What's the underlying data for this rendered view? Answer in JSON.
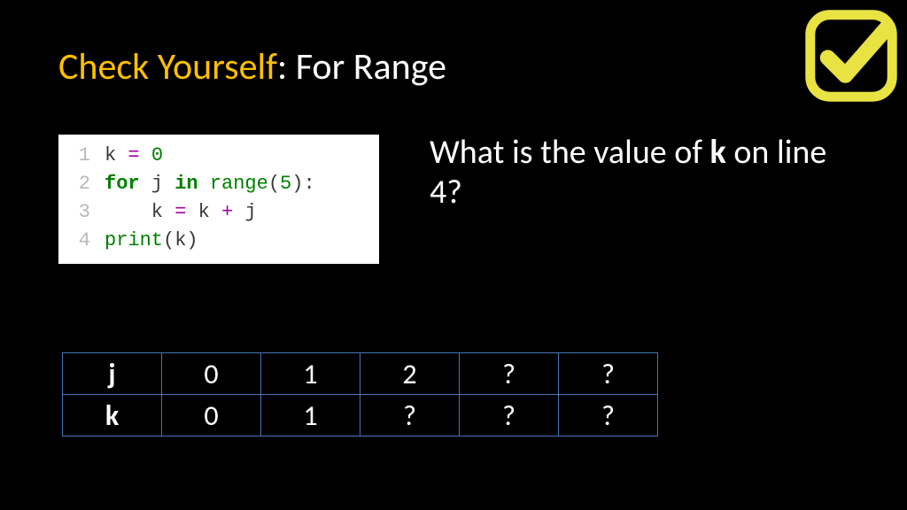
{
  "title": {
    "accent": "Check Yourself",
    "sep": ": ",
    "rest": "For Range"
  },
  "icon": {
    "name": "checkmark-box-icon"
  },
  "code": {
    "lines": [
      {
        "n": "1",
        "tokens": [
          {
            "t": "k ",
            "c": "plain"
          },
          {
            "t": "=",
            "c": "op"
          },
          {
            "t": " ",
            "c": "plain"
          },
          {
            "t": "0",
            "c": "num"
          }
        ]
      },
      {
        "n": "2",
        "tokens": [
          {
            "t": "for",
            "c": "kw"
          },
          {
            "t": " j ",
            "c": "plain"
          },
          {
            "t": "in",
            "c": "kw"
          },
          {
            "t": " ",
            "c": "plain"
          },
          {
            "t": "range",
            "c": "fn"
          },
          {
            "t": "(",
            "c": "plain"
          },
          {
            "t": "5",
            "c": "num"
          },
          {
            "t": "):",
            "c": "plain"
          }
        ]
      },
      {
        "n": "3",
        "tokens": [
          {
            "t": "    k ",
            "c": "plain"
          },
          {
            "t": "=",
            "c": "op"
          },
          {
            "t": " k ",
            "c": "plain"
          },
          {
            "t": "+",
            "c": "op"
          },
          {
            "t": " j",
            "c": "plain"
          }
        ]
      },
      {
        "n": "4",
        "tokens": [
          {
            "t": "print",
            "c": "fn"
          },
          {
            "t": "(k)",
            "c": "plain"
          }
        ]
      }
    ]
  },
  "question": {
    "pre": "What is the value of ",
    "var": "k",
    "post": " on line 4?"
  },
  "table": {
    "rows": [
      {
        "hdr": "j",
        "cells": [
          "0",
          "1",
          "2",
          "?",
          "?"
        ]
      },
      {
        "hdr": "k",
        "cells": [
          "0",
          "1",
          "?",
          "?",
          "?"
        ]
      }
    ]
  }
}
